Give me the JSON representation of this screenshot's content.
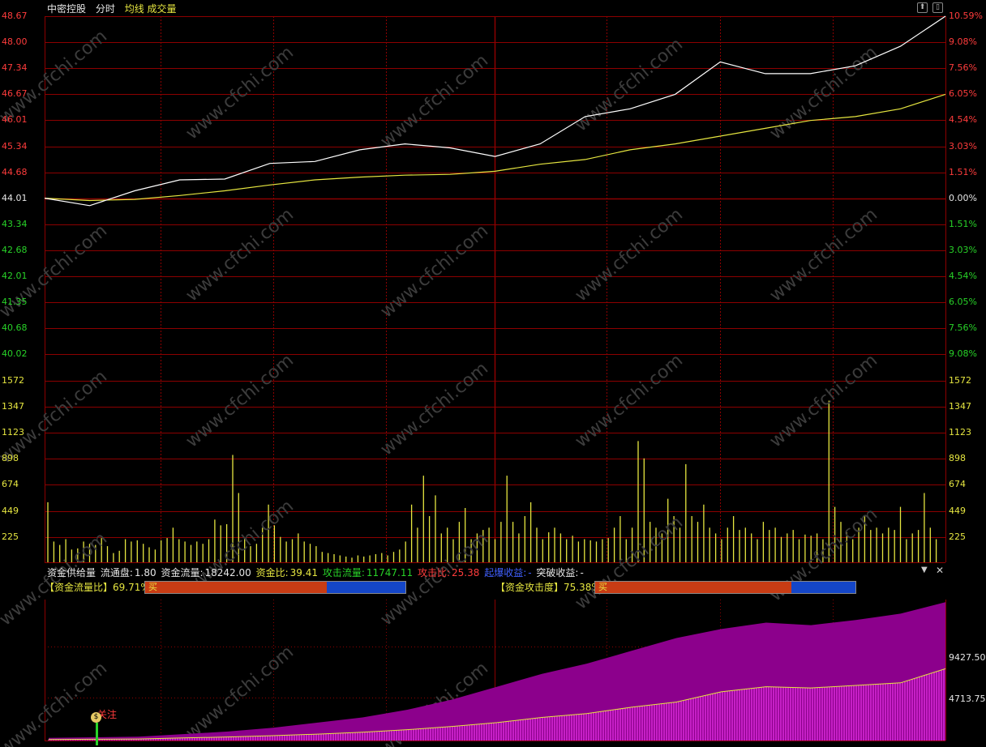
{
  "header": {
    "stock_name": "中密控股",
    "mode": "分时",
    "ma_label": "均线",
    "volume_label": "成交量"
  },
  "price_axis_left": [
    "48.67",
    "48.00",
    "47.34",
    "46.67",
    "46.01",
    "45.34",
    "44.68",
    "44.01",
    "43.34",
    "42.68",
    "42.01",
    "41.35",
    "40.68",
    "40.02"
  ],
  "price_axis_right": [
    "10.59%",
    "9.08%",
    "7.56%",
    "6.05%",
    "4.54%",
    "3.03%",
    "1.51%",
    "0.00%",
    "1.51%",
    "3.03%",
    "4.54%",
    "6.05%",
    "7.56%",
    "9.08%"
  ],
  "volume_axis": [
    "1572",
    "1347",
    "1123",
    "898",
    "674",
    "449",
    "225"
  ],
  "indicator": {
    "title": "资金供给量",
    "float_label": "流通盘:",
    "float_value": "1.80",
    "flow_label": "资金流量:",
    "flow_value": "18242.00",
    "ratio_label": "资金比:",
    "ratio_value": "39.41",
    "attack_flow_label": "攻击流量:",
    "attack_flow_value": "11747.11",
    "attack_ratio_label": "攻击比:",
    "attack_ratio_value": "25.38",
    "breakout_label": "起爆收益:",
    "breakout_value": "-",
    "break_gain_label": "突破收益:",
    "break_gain_value": "-",
    "flow_ratio_label": "【资金流量比】",
    "flow_ratio_value": "69.71",
    "flow_ratio_fill": 0.6971,
    "attack_degree_label": "【资金攻击度】",
    "attack_degree_value": "75.38",
    "attack_degree_fill": 0.7538,
    "percent_sign": "%",
    "buy_label": "买",
    "axis_top": "9427.50",
    "axis_mid": "4713.75",
    "signal_label": "关注",
    "signal_icon_glyph": "$"
  },
  "watermark_text": "www.cfchi.com",
  "colors": {
    "grid": "#8c0000",
    "price_line": "#ffffff",
    "avg_line": "#e6e640",
    "volume": "#e6e640",
    "purple": "#8c008c",
    "magenta": "#ff40ff"
  },
  "icons": {
    "maximize": "maximize-icon",
    "restore": "restore-icon",
    "dropdown": "dropdown-icon",
    "close": "close-icon"
  },
  "chart_data": [
    {
      "type": "line",
      "x": [
        0,
        12,
        24,
        36,
        48,
        60,
        72,
        84,
        96,
        108,
        120,
        132,
        144,
        156,
        168,
        180,
        192,
        204,
        216,
        228,
        240
      ],
      "series": [
        {
          "values": [
            44.01,
            43.82,
            44.2,
            44.48,
            44.5,
            44.9,
            44.95,
            45.25,
            45.4,
            45.3,
            45.08,
            45.4,
            46.1,
            46.3,
            46.67,
            47.5,
            47.2,
            47.2,
            47.4,
            47.9,
            48.67
          ]
        },
        {
          "values": [
            44.01,
            43.95,
            43.98,
            44.08,
            44.2,
            44.35,
            44.48,
            44.55,
            44.6,
            44.62,
            44.7,
            44.88,
            45.0,
            45.25,
            45.4,
            45.6,
            45.8,
            46.0,
            46.1,
            46.3,
            46.67
          ]
        }
      ],
      "ylim": [
        40.02,
        48.67
      ]
    },
    {
      "type": "bar",
      "values": [
        520,
        180,
        150,
        200,
        110,
        120,
        180,
        160,
        150,
        210,
        140,
        80,
        100,
        200,
        180,
        190,
        160,
        130,
        110,
        190,
        210,
        300,
        200,
        180,
        150,
        180,
        160,
        200,
        370,
        320,
        330,
        930,
        600,
        210,
        140,
        160,
        300,
        500,
        320,
        220,
        180,
        200,
        250,
        180,
        160,
        140,
        90,
        80,
        70,
        60,
        50,
        40,
        60,
        50,
        60,
        70,
        80,
        60,
        90,
        110,
        180,
        500,
        300,
        750,
        400,
        580,
        250,
        300,
        200,
        350,
        470,
        200,
        250,
        280,
        300,
        200,
        350,
        750,
        350,
        250,
        400,
        520,
        300,
        200,
        260,
        300,
        250,
        200,
        230,
        180,
        200,
        190,
        180,
        200,
        210,
        300,
        400,
        200,
        300,
        1050,
        900,
        350,
        300,
        250,
        550,
        400,
        300,
        850,
        400,
        350,
        500,
        300,
        250,
        200,
        300,
        400,
        280,
        300,
        250,
        200,
        350,
        280,
        300,
        220,
        250,
        280,
        200,
        240,
        230,
        250,
        200,
        1400,
        480,
        350,
        260,
        200,
        300,
        400,
        280,
        300,
        250,
        300,
        280,
        480,
        200,
        250,
        280,
        600,
        300,
        200
      ],
      "ylim": [
        0,
        1572
      ]
    },
    {
      "type": "area",
      "series": [
        {
          "values": [
            200,
            250,
            300,
            500,
            700,
            1000,
            1400,
            1800,
            2400,
            3200,
            4200,
            5200,
            6000,
            7000,
            8000,
            8700,
            9200,
            9000,
            9400,
            9900,
            10800
          ]
        },
        {
          "values": [
            80,
            100,
            120,
            200,
            280,
            380,
            500,
            650,
            850,
            1100,
            1400,
            1800,
            2100,
            2600,
            3000,
            3800,
            4200,
            4100,
            4300,
            4500,
            5600
          ]
        }
      ],
      "ylim": [
        0,
        11000
      ]
    }
  ]
}
